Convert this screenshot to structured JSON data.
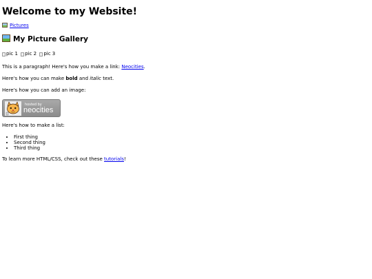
{
  "header": {
    "title": "Welcome to my Website!"
  },
  "nav": {
    "pictures_link": "Pictures"
  },
  "gallery": {
    "title": "My Picture Gallery",
    "images": [
      {
        "alt": "pic 1"
      },
      {
        "alt": "pic 2"
      },
      {
        "alt": "pic 3"
      }
    ]
  },
  "content": {
    "link_para_prefix": "This is a paragraph! Here's how you make a link: ",
    "link_text": "Neocities",
    "link_para_suffix": ".",
    "bold_para_prefix": "Here's how you can make ",
    "bold_word": "bold",
    "bold_para_middle": " and ",
    "italic_word": "italic",
    "bold_para_suffix": " text.",
    "image_para": "Here's how you can add an image:",
    "list_intro": "Here's how to make a list:",
    "list_items": [
      "First thing",
      "Second thing",
      "Third thing"
    ],
    "learn_prefix": "To learn more HTML/CSS, check out these ",
    "learn_link": "tutorials",
    "learn_suffix": "!"
  },
  "badge": {
    "small_text": "hosted by",
    "big_text": "neocities"
  },
  "icons": {
    "pictures_link_icon": "framed-picture-icon",
    "gallery_title_icon": "framed-picture-icon"
  }
}
